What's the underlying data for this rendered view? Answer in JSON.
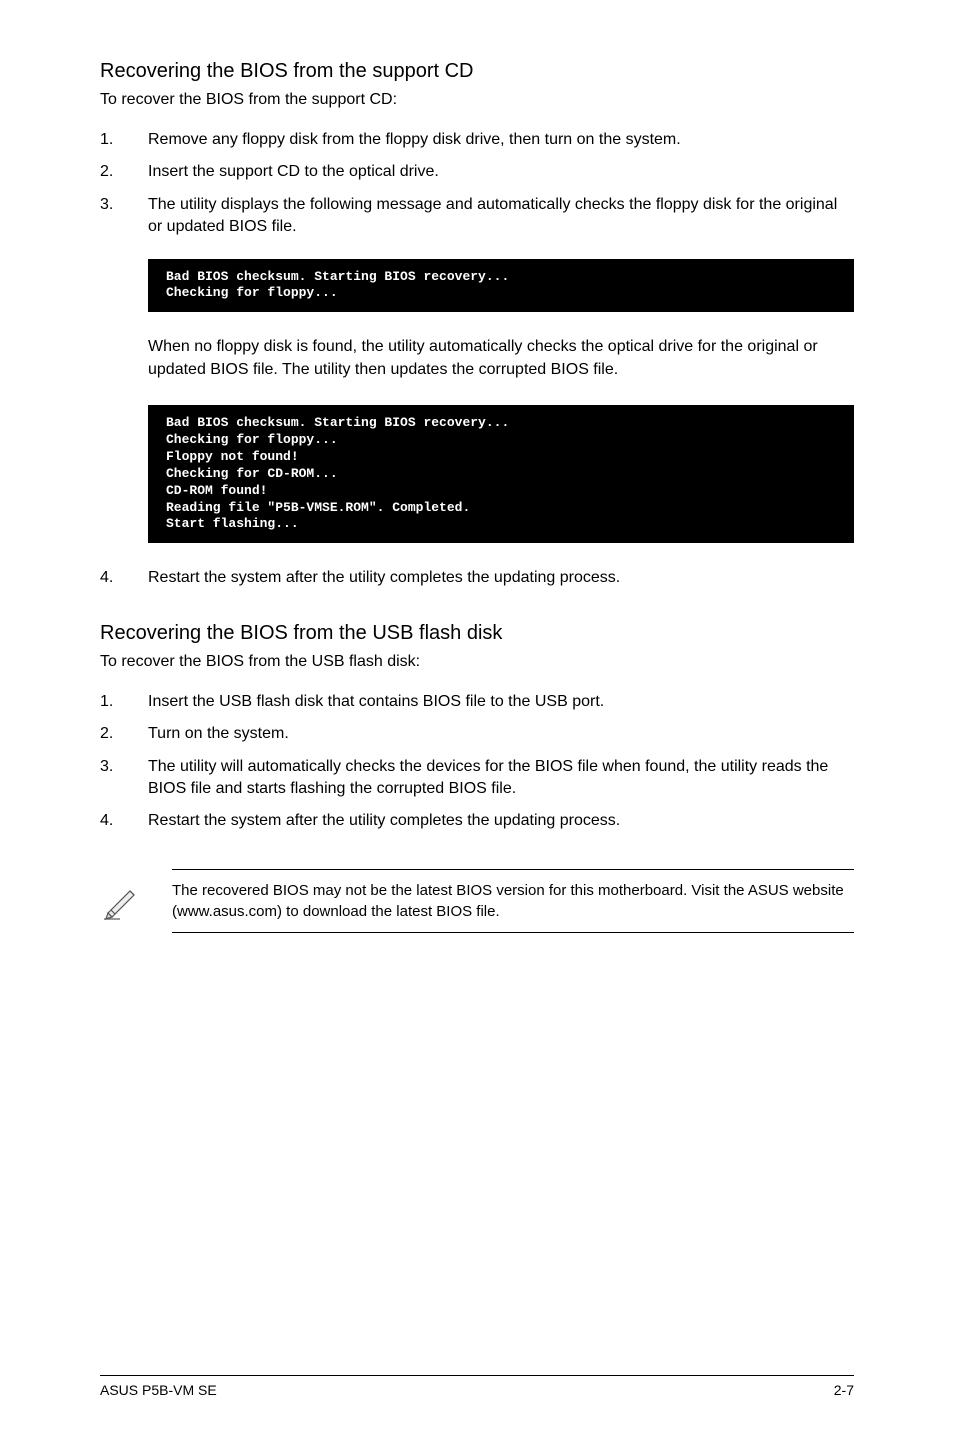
{
  "section1": {
    "title": "Recovering the BIOS from the support CD",
    "lead": "To recover the BIOS from the support CD:",
    "items": [
      {
        "num": "1.",
        "txt": "Remove any floppy disk from the floppy disk drive, then turn on the system."
      },
      {
        "num": "2.",
        "txt": "Insert the support CD to the optical drive."
      },
      {
        "num": "3.",
        "txt": "The utility displays the following message and automatically checks the floppy disk for the original or updated BIOS file."
      }
    ],
    "terminal1": "Bad BIOS checksum. Starting BIOS recovery...\nChecking for floppy...",
    "para1": "When no floppy disk is found, the utility automatically checks the optical drive for the original or updated BIOS file. The utility then updates the corrupted BIOS file.",
    "terminal2": "Bad BIOS checksum. Starting BIOS recovery...\nChecking for floppy...\nFloppy not found!\nChecking for CD-ROM...\nCD-ROM found!\nReading file \"P5B-VMSE.ROM\". Completed.\nStart flashing...\n",
    "item4": {
      "num": "4.",
      "txt": " Restart the system after the utility completes the updating process."
    }
  },
  "section2": {
    "title": "Recovering the BIOS from the USB flash disk",
    "lead": "To recover the BIOS from the USB flash disk:",
    "items": [
      {
        "num": "1.",
        "txt": "Insert the USB flash disk that contains BIOS file to the USB port."
      },
      {
        "num": "2.",
        "txt": "Turn on the system."
      },
      {
        "num": "3.",
        "txt": "The utility will automatically checks the devices for the BIOS file when found, the utility reads the BIOS file and starts flashing the corrupted BIOS file."
      },
      {
        "num": "4.",
        "txt": "Restart the system after the utility completes the updating process."
      }
    ]
  },
  "note": {
    "text": "The recovered BIOS may not be the latest BIOS version for this motherboard. Visit the ASUS website (www.asus.com) to download the latest BIOS file."
  },
  "footer": {
    "left": "ASUS P5B-VM SE",
    "right": "2-7"
  }
}
